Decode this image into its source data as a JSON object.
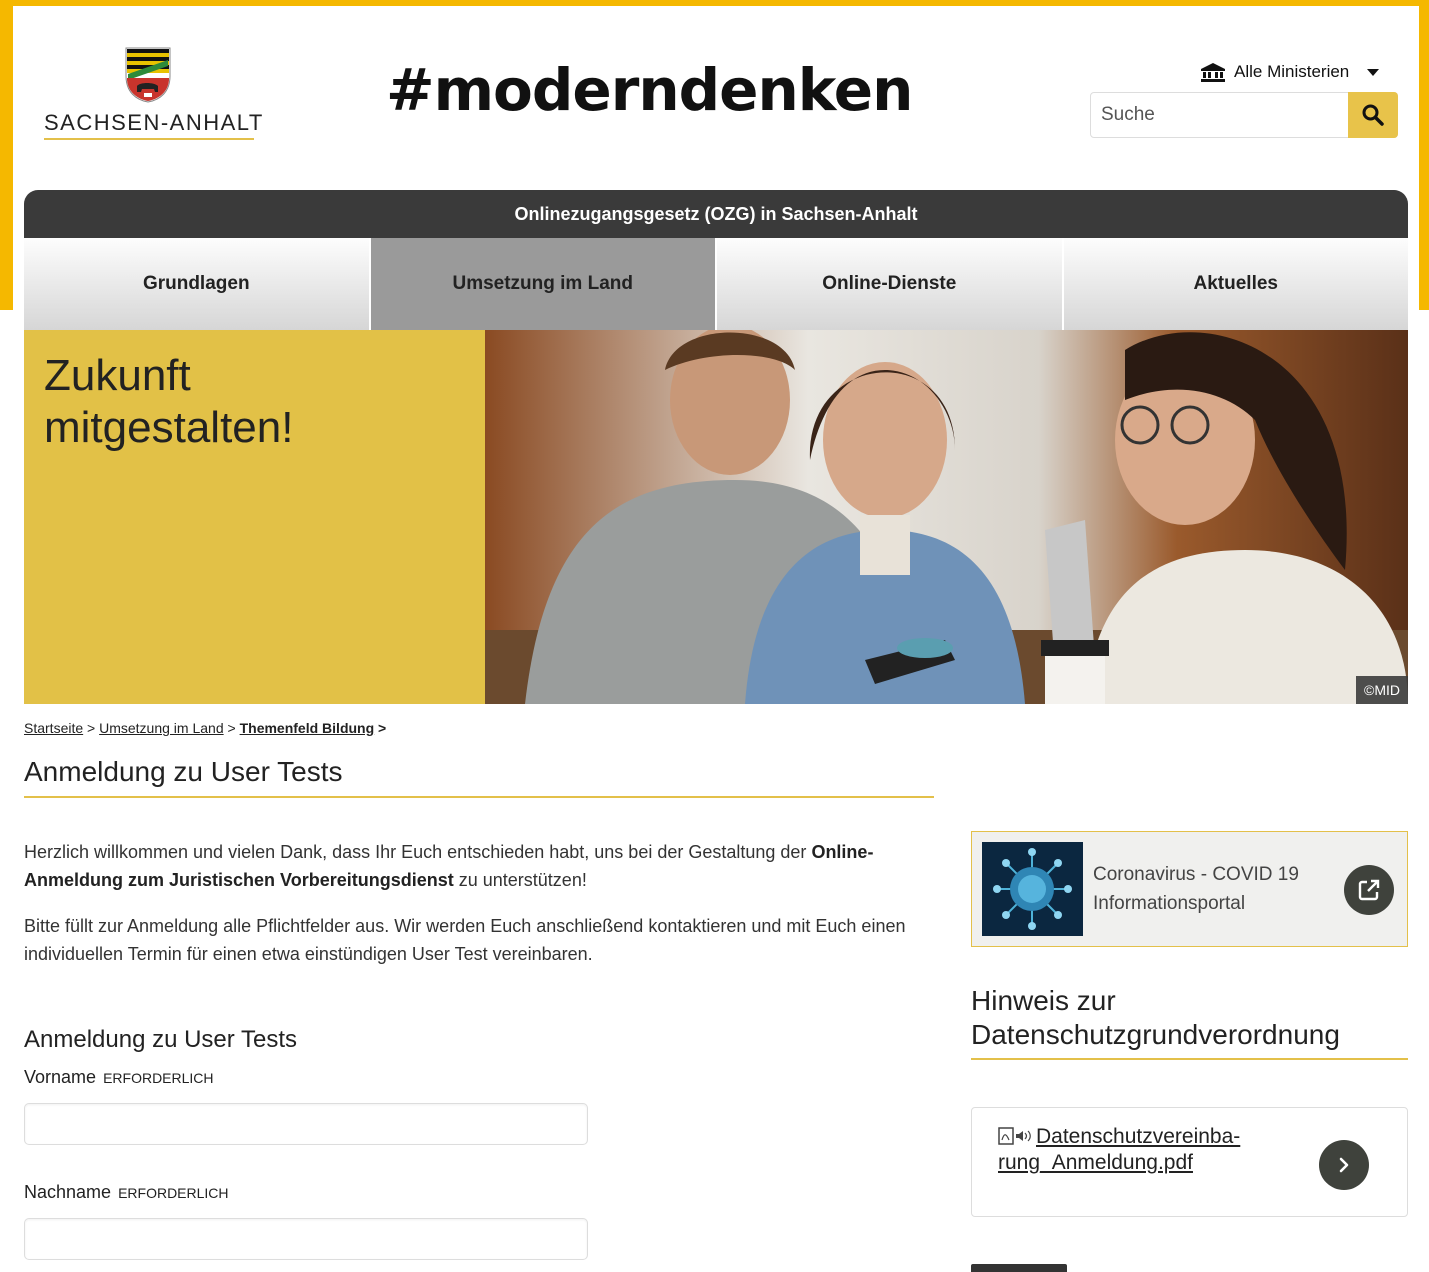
{
  "header": {
    "logo_text": "SACHSEN-ANHALT",
    "hashtag": "#moderndenken",
    "ministries_label": "Alle Ministerien",
    "search": {
      "placeholder": "Suche",
      "value": ""
    }
  },
  "ozg_bar": {
    "label": "Onlinezugangsgesetz (OZG) in Sachsen-Anhalt"
  },
  "nav": {
    "tabs": [
      {
        "label": "Grundlagen",
        "active": false
      },
      {
        "label": "Umsetzung im Land",
        "active": true
      },
      {
        "label": "Online-Dienste",
        "active": false
      },
      {
        "label": "Aktuelles",
        "active": false
      }
    ]
  },
  "hero": {
    "title_line1": "Zukunft",
    "title_line2": "mitgestalten!",
    "credit": "©MID"
  },
  "breadcrumb": {
    "items": [
      "Startseite",
      "Umsetzung im Land",
      "Themenfeld Bildung"
    ],
    "separator": ">"
  },
  "main": {
    "title": "Anmeldung zu User Tests",
    "intro": {
      "p1_start": "Herzlich willkommen und vielen Dank, dass Ihr Euch entschieden habt, uns bei der Gestaltung der",
      "p1_bold": "Online-Anmeldung zum Juristischen Vorbereitungsdienst",
      "p1_end": "zu unterstützen!",
      "p2": "Bitte füllt zur Anmeldung alle Pflichtfelder aus. Wir werden Euch anschließend kontaktieren und mit Euch einen individuellen Termin für einen etwa einstündigen User Test vereinbaren."
    },
    "form": {
      "heading": "Anmeldung zu User Tests",
      "fields": [
        {
          "label": "Vorname",
          "required_label": "ERFORDERLICH",
          "value": ""
        },
        {
          "label": "Nachname",
          "required_label": "ERFORDERLICH",
          "value": ""
        }
      ]
    }
  },
  "sidebar": {
    "covid": {
      "line1": "Coronavirus - COVID 19",
      "line2": "Informationsportal"
    },
    "hint_heading_line1": "Hinweis zur",
    "hint_heading_line2": "Datenschutzgrundverordnung",
    "pdf": {
      "line1": "Datenschutzvereinba-",
      "line2": "rung_Anmeldung.pdf"
    }
  },
  "colors": {
    "accent_yellow": "#e2c147",
    "frame_yellow": "#f5b800",
    "dark_bar": "#3a3a3a"
  },
  "icons": [
    "crest-icon",
    "bank-icon",
    "search-icon",
    "external-link-icon",
    "pdf-audio-icon",
    "chevron-right-icon"
  ]
}
